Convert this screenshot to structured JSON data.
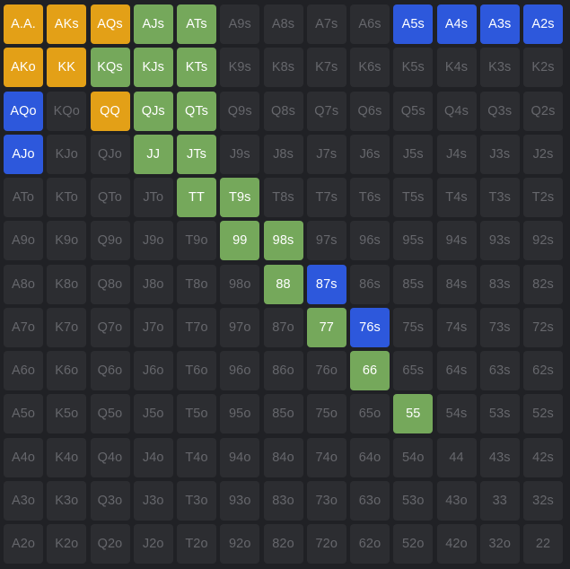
{
  "colors": {
    "background": "#202125",
    "none": "#2c2d31",
    "raise": "#e3a017",
    "call": "#75a85b",
    "bluff": "#2d58dc",
    "text_muted": "#66676c",
    "text_active": "#ffffff"
  },
  "grid": {
    "rows": [
      [
        {
          "label": "A.A.",
          "action": "raise"
        },
        {
          "label": "AKs",
          "action": "raise"
        },
        {
          "label": "AQs",
          "action": "raise"
        },
        {
          "label": "AJs",
          "action": "call"
        },
        {
          "label": "ATs",
          "action": "call"
        },
        {
          "label": "A9s",
          "action": "none"
        },
        {
          "label": "A8s",
          "action": "none"
        },
        {
          "label": "A7s",
          "action": "none"
        },
        {
          "label": "A6s",
          "action": "none"
        },
        {
          "label": "A5s",
          "action": "bluff"
        },
        {
          "label": "A4s",
          "action": "bluff"
        },
        {
          "label": "A3s",
          "action": "bluff"
        },
        {
          "label": "A2s",
          "action": "bluff"
        }
      ],
      [
        {
          "label": "AKo",
          "action": "raise"
        },
        {
          "label": "KK",
          "action": "raise"
        },
        {
          "label": "KQs",
          "action": "call"
        },
        {
          "label": "KJs",
          "action": "call"
        },
        {
          "label": "KTs",
          "action": "call"
        },
        {
          "label": "K9s",
          "action": "none"
        },
        {
          "label": "K8s",
          "action": "none"
        },
        {
          "label": "K7s",
          "action": "none"
        },
        {
          "label": "K6s",
          "action": "none"
        },
        {
          "label": "K5s",
          "action": "none"
        },
        {
          "label": "K4s",
          "action": "none"
        },
        {
          "label": "K3s",
          "action": "none"
        },
        {
          "label": "K2s",
          "action": "none"
        }
      ],
      [
        {
          "label": "AQo",
          "action": "bluff"
        },
        {
          "label": "KQo",
          "action": "none"
        },
        {
          "label": "QQ",
          "action": "raise"
        },
        {
          "label": "QJs",
          "action": "call"
        },
        {
          "label": "QTs",
          "action": "call"
        },
        {
          "label": "Q9s",
          "action": "none"
        },
        {
          "label": "Q8s",
          "action": "none"
        },
        {
          "label": "Q7s",
          "action": "none"
        },
        {
          "label": "Q6s",
          "action": "none"
        },
        {
          "label": "Q5s",
          "action": "none"
        },
        {
          "label": "Q4s",
          "action": "none"
        },
        {
          "label": "Q3s",
          "action": "none"
        },
        {
          "label": "Q2s",
          "action": "none"
        }
      ],
      [
        {
          "label": "AJo",
          "action": "bluff"
        },
        {
          "label": "KJo",
          "action": "none"
        },
        {
          "label": "QJo",
          "action": "none"
        },
        {
          "label": "JJ",
          "action": "call"
        },
        {
          "label": "JTs",
          "action": "call"
        },
        {
          "label": "J9s",
          "action": "none"
        },
        {
          "label": "J8s",
          "action": "none"
        },
        {
          "label": "J7s",
          "action": "none"
        },
        {
          "label": "J6s",
          "action": "none"
        },
        {
          "label": "J5s",
          "action": "none"
        },
        {
          "label": "J4s",
          "action": "none"
        },
        {
          "label": "J3s",
          "action": "none"
        },
        {
          "label": "J2s",
          "action": "none"
        }
      ],
      [
        {
          "label": "ATo",
          "action": "none"
        },
        {
          "label": "KTo",
          "action": "none"
        },
        {
          "label": "QTo",
          "action": "none"
        },
        {
          "label": "JTo",
          "action": "none"
        },
        {
          "label": "TT",
          "action": "call"
        },
        {
          "label": "T9s",
          "action": "call"
        },
        {
          "label": "T8s",
          "action": "none"
        },
        {
          "label": "T7s",
          "action": "none"
        },
        {
          "label": "T6s",
          "action": "none"
        },
        {
          "label": "T5s",
          "action": "none"
        },
        {
          "label": "T4s",
          "action": "none"
        },
        {
          "label": "T3s",
          "action": "none"
        },
        {
          "label": "T2s",
          "action": "none"
        }
      ],
      [
        {
          "label": "A9o",
          "action": "none"
        },
        {
          "label": "K9o",
          "action": "none"
        },
        {
          "label": "Q9o",
          "action": "none"
        },
        {
          "label": "J9o",
          "action": "none"
        },
        {
          "label": "T9o",
          "action": "none"
        },
        {
          "label": "99",
          "action": "call"
        },
        {
          "label": "98s",
          "action": "call"
        },
        {
          "label": "97s",
          "action": "none"
        },
        {
          "label": "96s",
          "action": "none"
        },
        {
          "label": "95s",
          "action": "none"
        },
        {
          "label": "94s",
          "action": "none"
        },
        {
          "label": "93s",
          "action": "none"
        },
        {
          "label": "92s",
          "action": "none"
        }
      ],
      [
        {
          "label": "A8o",
          "action": "none"
        },
        {
          "label": "K8o",
          "action": "none"
        },
        {
          "label": "Q8o",
          "action": "none"
        },
        {
          "label": "J8o",
          "action": "none"
        },
        {
          "label": "T8o",
          "action": "none"
        },
        {
          "label": "98o",
          "action": "none"
        },
        {
          "label": "88",
          "action": "call"
        },
        {
          "label": "87s",
          "action": "bluff"
        },
        {
          "label": "86s",
          "action": "none"
        },
        {
          "label": "85s",
          "action": "none"
        },
        {
          "label": "84s",
          "action": "none"
        },
        {
          "label": "83s",
          "action": "none"
        },
        {
          "label": "82s",
          "action": "none"
        }
      ],
      [
        {
          "label": "A7o",
          "action": "none"
        },
        {
          "label": "K7o",
          "action": "none"
        },
        {
          "label": "Q7o",
          "action": "none"
        },
        {
          "label": "J7o",
          "action": "none"
        },
        {
          "label": "T7o",
          "action": "none"
        },
        {
          "label": "97o",
          "action": "none"
        },
        {
          "label": "87o",
          "action": "none"
        },
        {
          "label": "77",
          "action": "call"
        },
        {
          "label": "76s",
          "action": "bluff"
        },
        {
          "label": "75s",
          "action": "none"
        },
        {
          "label": "74s",
          "action": "none"
        },
        {
          "label": "73s",
          "action": "none"
        },
        {
          "label": "72s",
          "action": "none"
        }
      ],
      [
        {
          "label": "A6o",
          "action": "none"
        },
        {
          "label": "K6o",
          "action": "none"
        },
        {
          "label": "Q6o",
          "action": "none"
        },
        {
          "label": "J6o",
          "action": "none"
        },
        {
          "label": "T6o",
          "action": "none"
        },
        {
          "label": "96o",
          "action": "none"
        },
        {
          "label": "86o",
          "action": "none"
        },
        {
          "label": "76o",
          "action": "none"
        },
        {
          "label": "66",
          "action": "call"
        },
        {
          "label": "65s",
          "action": "none"
        },
        {
          "label": "64s",
          "action": "none"
        },
        {
          "label": "63s",
          "action": "none"
        },
        {
          "label": "62s",
          "action": "none"
        }
      ],
      [
        {
          "label": "A5o",
          "action": "none"
        },
        {
          "label": "K5o",
          "action": "none"
        },
        {
          "label": "Q5o",
          "action": "none"
        },
        {
          "label": "J5o",
          "action": "none"
        },
        {
          "label": "T5o",
          "action": "none"
        },
        {
          "label": "95o",
          "action": "none"
        },
        {
          "label": "85o",
          "action": "none"
        },
        {
          "label": "75o",
          "action": "none"
        },
        {
          "label": "65o",
          "action": "none"
        },
        {
          "label": "55",
          "action": "call"
        },
        {
          "label": "54s",
          "action": "none"
        },
        {
          "label": "53s",
          "action": "none"
        },
        {
          "label": "52s",
          "action": "none"
        }
      ],
      [
        {
          "label": "A4o",
          "action": "none"
        },
        {
          "label": "K4o",
          "action": "none"
        },
        {
          "label": "Q4o",
          "action": "none"
        },
        {
          "label": "J4o",
          "action": "none"
        },
        {
          "label": "T4o",
          "action": "none"
        },
        {
          "label": "94o",
          "action": "none"
        },
        {
          "label": "84o",
          "action": "none"
        },
        {
          "label": "74o",
          "action": "none"
        },
        {
          "label": "64o",
          "action": "none"
        },
        {
          "label": "54o",
          "action": "none"
        },
        {
          "label": "44",
          "action": "none"
        },
        {
          "label": "43s",
          "action": "none"
        },
        {
          "label": "42s",
          "action": "none"
        }
      ],
      [
        {
          "label": "A3o",
          "action": "none"
        },
        {
          "label": "K3o",
          "action": "none"
        },
        {
          "label": "Q3o",
          "action": "none"
        },
        {
          "label": "J3o",
          "action": "none"
        },
        {
          "label": "T3o",
          "action": "none"
        },
        {
          "label": "93o",
          "action": "none"
        },
        {
          "label": "83o",
          "action": "none"
        },
        {
          "label": "73o",
          "action": "none"
        },
        {
          "label": "63o",
          "action": "none"
        },
        {
          "label": "53o",
          "action": "none"
        },
        {
          "label": "43o",
          "action": "none"
        },
        {
          "label": "33",
          "action": "none"
        },
        {
          "label": "32s",
          "action": "none"
        }
      ],
      [
        {
          "label": "A2o",
          "action": "none"
        },
        {
          "label": "K2o",
          "action": "none"
        },
        {
          "label": "Q2o",
          "action": "none"
        },
        {
          "label": "J2o",
          "action": "none"
        },
        {
          "label": "T2o",
          "action": "none"
        },
        {
          "label": "92o",
          "action": "none"
        },
        {
          "label": "82o",
          "action": "none"
        },
        {
          "label": "72o",
          "action": "none"
        },
        {
          "label": "62o",
          "action": "none"
        },
        {
          "label": "52o",
          "action": "none"
        },
        {
          "label": "42o",
          "action": "none"
        },
        {
          "label": "32o",
          "action": "none"
        },
        {
          "label": "22",
          "action": "none"
        }
      ]
    ]
  }
}
